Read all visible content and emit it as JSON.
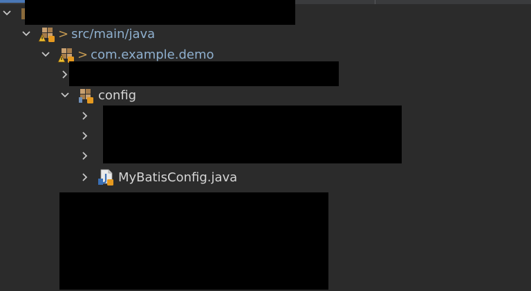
{
  "tree": {
    "source_folder": {
      "prefix": ">",
      "label": "src/main/java",
      "icon": "package-folder-warning-icon"
    },
    "root_package": {
      "prefix": ">",
      "label": "com.example.demo",
      "icon": "package-warning-icon"
    },
    "config_package": {
      "label": "config",
      "icon": "package-icon"
    },
    "mybatis_file": {
      "label": "MyBatisConfig.java",
      "icon": "java-file-icon"
    }
  },
  "colors": {
    "background": "#2b2b2b",
    "text_primary": "#d6d6d6",
    "text_blue": "#8fb0cf",
    "decorator_orange": "#c89c52",
    "accent": "#4a78b7"
  }
}
